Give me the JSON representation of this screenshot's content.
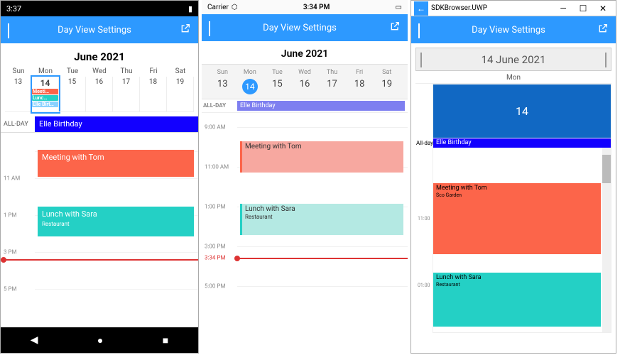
{
  "colors": {
    "primary": "#2d99ff",
    "allday": "#1200ff",
    "event1": "#fc654a",
    "event2": "#24d0c5",
    "now": "#d33",
    "uwp_bignum": "#1168c3",
    "ios_allday": "#7e7ff0"
  },
  "android": {
    "status_time": "3:37",
    "header_title": "Day View Settings",
    "month_title": "June 2021",
    "days_of_week": [
      "Sun",
      "Mon",
      "Tue",
      "Wed",
      "Thu",
      "Fri",
      "Sat"
    ],
    "dates": [
      "13",
      "14",
      "15",
      "16",
      "17",
      "18",
      "19"
    ],
    "selected_index": 1,
    "sel_chips": [
      {
        "label": "Meeti…",
        "color": "#fc654a"
      },
      {
        "label": "Lunc…",
        "color": "#24d0c5"
      },
      {
        "label": "Elle Birt…",
        "color": "#8ad1ff"
      }
    ],
    "allday_label": "ALL-DAY",
    "allday_event": "Elle Birthday",
    "time_labels": [
      "11 AM",
      "1 PM",
      "3 PM",
      "5 PM"
    ],
    "events": [
      {
        "title": "Meeting with Tom",
        "sub": "",
        "color": "#fc654a"
      },
      {
        "title": "Lunch with Sara",
        "sub": "Restaurant",
        "color": "#24d0c5"
      }
    ]
  },
  "ios": {
    "status_carrier": "Carrier",
    "status_time": "3:34 PM",
    "header_title": "Day View Settings",
    "month_title": "June 2021",
    "days_of_week": [
      "Sun",
      "Mon",
      "Tue",
      "Wed",
      "Thu",
      "Fri",
      "Sat"
    ],
    "dates": [
      "13",
      "14",
      "15",
      "16",
      "17",
      "18",
      "19"
    ],
    "selected_index": 1,
    "allday_label": "ALL-DAY",
    "allday_event": "Elle Birthday",
    "time_labels": [
      "9:00 AM",
      "11:00 AM",
      "1:00 PM",
      "3:00 PM",
      "5:00 PM"
    ],
    "now_label": "3:34 PM",
    "events": [
      {
        "title": "Meeting with Tom",
        "sub": "",
        "color": "#f7a8a0",
        "border": "#fc654a"
      },
      {
        "title": "Lunch with Sara",
        "sub": "Restaurant",
        "color": "#b4e9e3",
        "border": "#24d0c5"
      }
    ]
  },
  "uwp": {
    "window_title": "SDKBrowser.UWP",
    "window_buttons": [
      "—",
      "☐",
      "✕"
    ],
    "header_title": "Day View Settings",
    "date_header": "14 June 2021",
    "dow_label": "Mon",
    "big_num": "14",
    "allday_label": "All-day",
    "allday_event": "Elle Birthday",
    "time_labels": [
      "11:00",
      "01:00"
    ],
    "events": [
      {
        "title": "Meeting with Tom",
        "sub": "Sco Garden",
        "color": "#fc654a"
      },
      {
        "title": "Lunch with Sara",
        "sub": "Restaurant",
        "color": "#24d0c5"
      }
    ]
  }
}
